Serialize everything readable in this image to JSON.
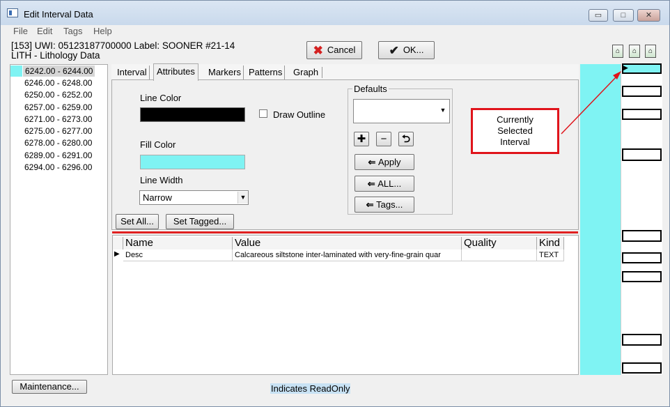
{
  "window": {
    "title": "Edit Interval Data",
    "minimize": "▭",
    "maximize": "□",
    "close": "✕"
  },
  "menu": [
    "File",
    "Edit",
    "Tags",
    "Help"
  ],
  "header": {
    "line1": "[153] UWI: 05123187700000  Label: SOONER #21-14",
    "line2": "LITH - Lithology Data"
  },
  "toolbar": {
    "cancel_label": "Cancel",
    "ok_label": "OK..."
  },
  "intervals": [
    "6242.00 - 6244.00",
    "6246.00 - 6248.00",
    "6250.00 - 6252.00",
    "6257.00 - 6259.00",
    "6271.00 - 6273.00",
    "6275.00 - 6277.00",
    "6278.00 - 6280.00",
    "6289.00 - 6291.00",
    "6294.00 - 6296.00"
  ],
  "selected_interval_index": 0,
  "tabs": [
    "Interval",
    "Attributes",
    "Markers",
    "Patterns",
    "Graph"
  ],
  "active_tab": "Attributes",
  "attributes": {
    "line_color_label": "Line Color",
    "draw_outline_label": "Draw Outline",
    "fill_color_label": "Fill Color",
    "line_width_label": "Line Width",
    "line_width_value": "Narrow",
    "set_all_label": "Set All...",
    "set_tagged_label": "Set Tagged...",
    "line_color": "#000000",
    "fill_color": "#7ff3f3"
  },
  "defaults": {
    "legend": "Defaults",
    "selected": "",
    "apply_label": "Apply",
    "all_label": "ALL...",
    "tags_label": "Tags..."
  },
  "callout": {
    "line1": "Currently",
    "line2": "Selected",
    "line3": "Interval"
  },
  "grid": {
    "columns": [
      "Name",
      "Value",
      "Quality",
      "Kind"
    ],
    "rows": [
      {
        "name": "Desc",
        "value": "Calcareous siltstone inter-laminated with very-fine-grain quar",
        "quality": "",
        "kind": "TEXT"
      }
    ]
  },
  "footer": {
    "maintenance_label": "Maintenance...",
    "readonly_label": "Indicates ReadOnly"
  }
}
